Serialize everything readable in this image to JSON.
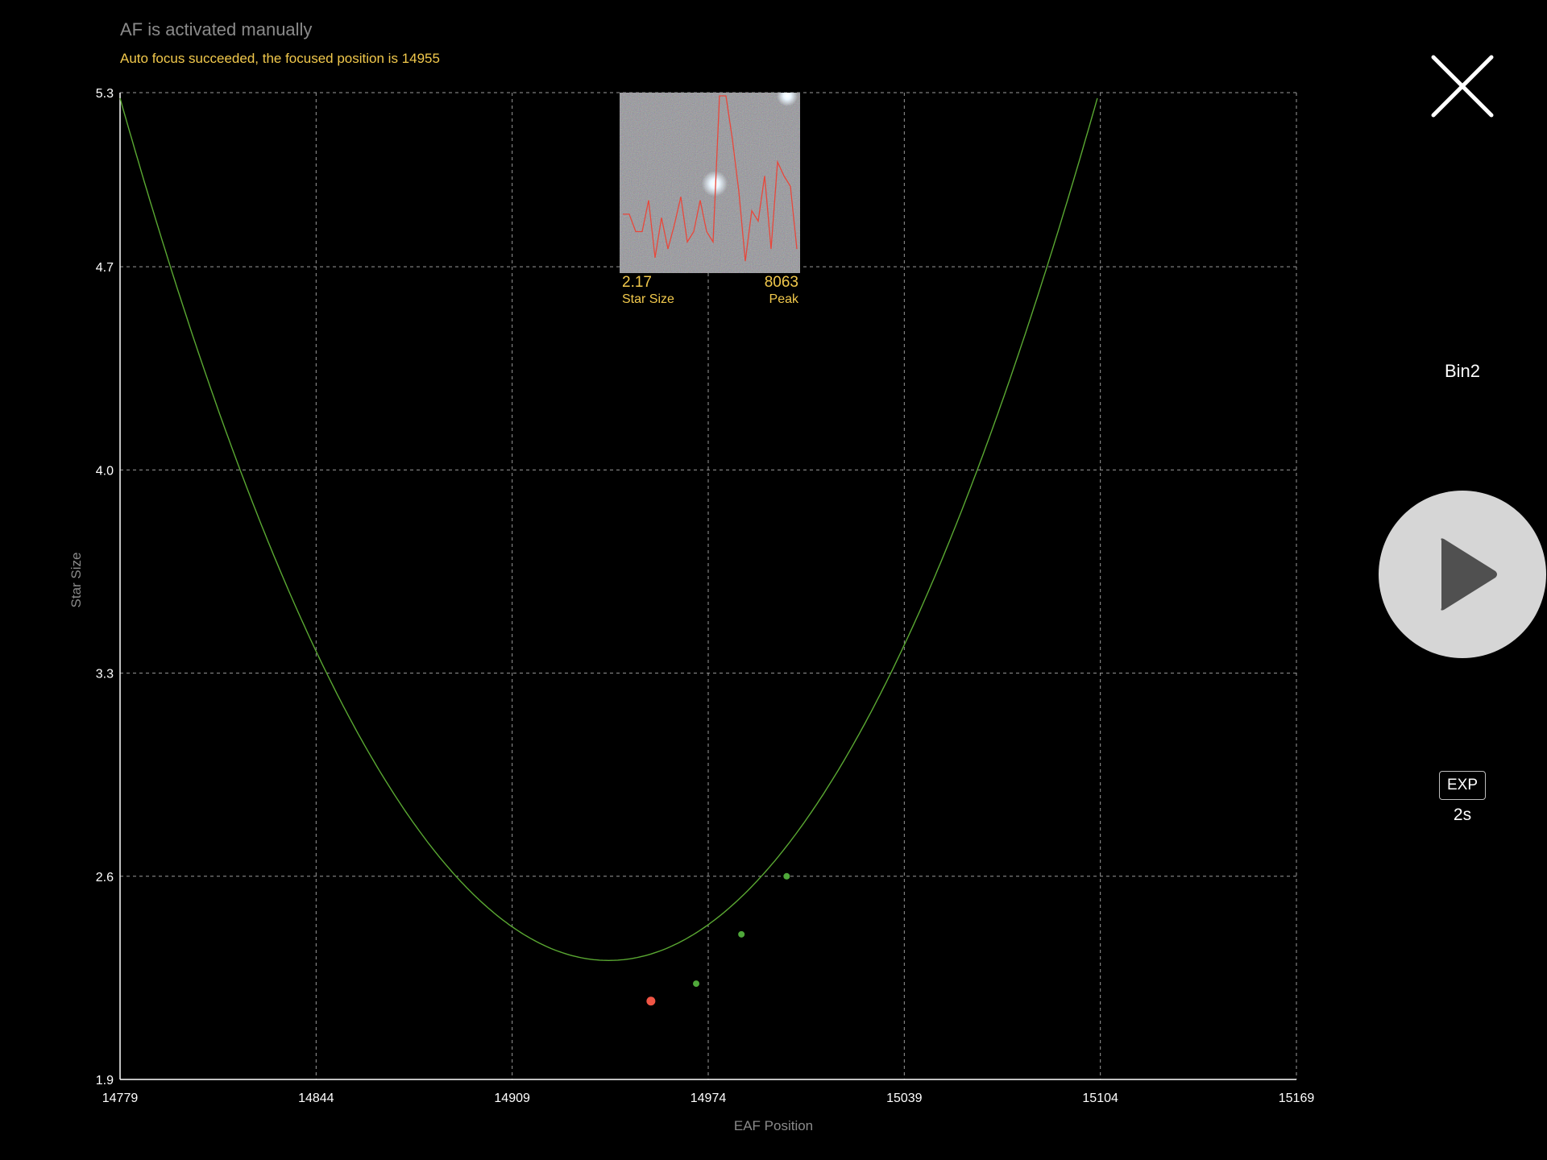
{
  "header": {
    "status": "AF is activated manually",
    "result": "Auto focus succeeded, the focused position is 14955"
  },
  "controls": {
    "binning": "Bin2",
    "exp_label": "EXP",
    "exp_value": "2s",
    "close_icon": "close-icon",
    "play_icon": "play-icon"
  },
  "inset": {
    "star_size_value": "2.17",
    "star_size_label": "Star Size",
    "peak_value": "8063",
    "peak_label": "Peak",
    "profile_color": "#e8473b",
    "profile": [
      0.68,
      0.68,
      0.78,
      0.78,
      0.6,
      0.93,
      0.7,
      0.88,
      0.74,
      0.58,
      0.84,
      0.78,
      0.6,
      0.78,
      0.84,
      0.0,
      0.0,
      0.25,
      0.55,
      0.95,
      0.66,
      0.72,
      0.46,
      0.88,
      0.38,
      0.46,
      0.52,
      0.88
    ]
  },
  "chart_data": {
    "type": "scatter",
    "xlabel": "EAF Position",
    "ylabel": "Star Size",
    "xlim": [
      14779,
      15169
    ],
    "ylim": [
      1.9,
      5.3
    ],
    "xticks": [
      "14779",
      "14844",
      "14909",
      "14974",
      "15039",
      "15104",
      "15169"
    ],
    "yticks": [
      "5.3",
      "4.7",
      "4.0",
      "3.3",
      "2.6",
      "1.9"
    ],
    "grid": true,
    "curve_color": "#5aa832",
    "curve": {
      "vertex_x": 14941,
      "vertex_y": 2.31,
      "a": 0.0001132
    },
    "points": [
      {
        "x": 14955,
        "y": 2.17,
        "color": "#f05545"
      },
      {
        "x": 14970,
        "y": 2.23,
        "color": "#4fa83a"
      },
      {
        "x": 14985,
        "y": 2.4,
        "color": "#4fa83a"
      },
      {
        "x": 15000,
        "y": 2.6,
        "color": "#4fa83a"
      }
    ]
  }
}
